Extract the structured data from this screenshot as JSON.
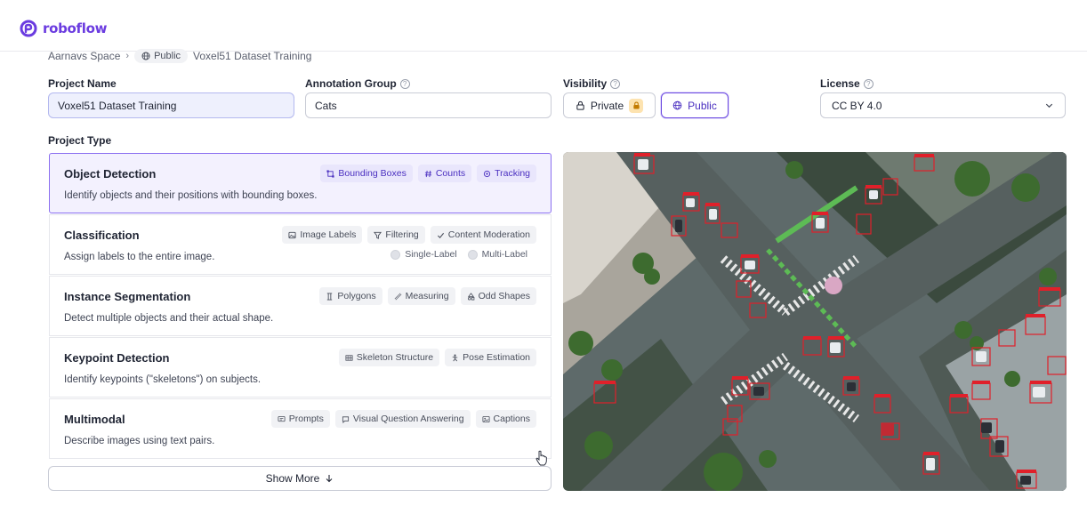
{
  "brand": {
    "name": "roboflow",
    "color": "#6b3ce0"
  },
  "breadcrumb": {
    "workspace": "Aarnavs Space",
    "visibility_badge": "Public",
    "project": "Voxel51 Dataset Training"
  },
  "form": {
    "project_name": {
      "label": "Project Name",
      "value": "Voxel51 Dataset Training"
    },
    "annotation_group": {
      "label": "Annotation Group",
      "value": "Cats"
    },
    "visibility": {
      "label": "Visibility",
      "options": [
        "Private",
        "Public"
      ],
      "selected": "Public"
    },
    "license": {
      "label": "License",
      "value": "CC BY 4.0"
    }
  },
  "project_type": {
    "label": "Project Type",
    "selected": "Object Detection",
    "types": [
      {
        "title": "Object Detection",
        "desc": "Identify objects and their positions with bounding boxes.",
        "tags": [
          {
            "icon": "bounding-box-icon",
            "label": "Bounding Boxes"
          },
          {
            "icon": "hash-icon",
            "label": "Counts"
          },
          {
            "icon": "tracking-icon",
            "label": "Tracking"
          }
        ]
      },
      {
        "title": "Classification",
        "desc": "Assign labels to the entire image.",
        "tags": [
          {
            "icon": "image-icon",
            "label": "Image Labels"
          },
          {
            "icon": "filter-icon",
            "label": "Filtering"
          },
          {
            "icon": "check-icon",
            "label": "Content Moderation"
          }
        ],
        "options": [
          "Single-Label",
          "Multi-Label"
        ]
      },
      {
        "title": "Instance Segmentation",
        "desc": "Detect multiple objects and their actual shape.",
        "tags": [
          {
            "icon": "polygon-icon",
            "label": "Polygons"
          },
          {
            "icon": "ruler-icon",
            "label": "Measuring"
          },
          {
            "icon": "shapes-icon",
            "label": "Odd Shapes"
          }
        ]
      },
      {
        "title": "Keypoint Detection",
        "desc": "Identify keypoints (\"skeletons\") on subjects.",
        "tags": [
          {
            "icon": "skeleton-icon",
            "label": "Skeleton Structure"
          },
          {
            "icon": "pose-icon",
            "label": "Pose Estimation"
          }
        ]
      },
      {
        "title": "Multimodal",
        "desc": "Describe images using text pairs.",
        "tags": [
          {
            "icon": "prompt-icon",
            "label": "Prompts"
          },
          {
            "icon": "chat-icon",
            "label": "Visual Question Answering"
          },
          {
            "icon": "caption-icon",
            "label": "Captions"
          }
        ]
      }
    ],
    "show_more": "Show More"
  },
  "colors": {
    "accent": "#6a48e0",
    "selected_bg": "#f3f1fe",
    "detection_box": "#e0202a"
  }
}
